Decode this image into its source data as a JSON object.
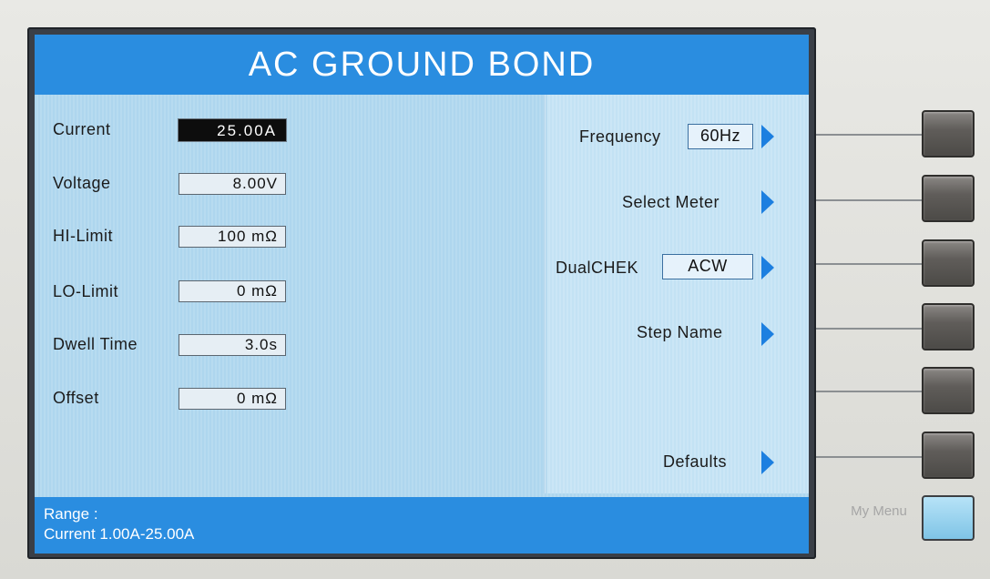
{
  "title": "AC GROUND BOND",
  "params": [
    {
      "label": "Current",
      "value": "25.00A",
      "selected": true
    },
    {
      "label": "Voltage",
      "value": "8.00V"
    },
    {
      "label": "HI-Limit",
      "value": "100 mΩ"
    },
    {
      "label": "LO-Limit",
      "value": "0 mΩ"
    },
    {
      "label": "Dwell Time",
      "value": "3.0s"
    },
    {
      "label": "Offset",
      "value": "0 mΩ"
    }
  ],
  "menu": {
    "frequency_label": "Frequency",
    "frequency_value": "60Hz",
    "select_meter_label": "Select Meter",
    "dualchek_label": "DualCHEK",
    "dualchek_value": "ACW",
    "step_name_label": "Step Name",
    "defaults_label": "Defaults"
  },
  "status": {
    "line1": "Range :",
    "line2": "Current 1.00A-25.00A"
  },
  "my_menu_label": "My Menu",
  "colors": {
    "title_bar": "#2a8de0",
    "screen_bg": "#b2d8ee",
    "arrow": "#1c7fe0",
    "my_menu_key": "#9fd3ee"
  },
  "icons": [
    "arrow-right-icon"
  ]
}
